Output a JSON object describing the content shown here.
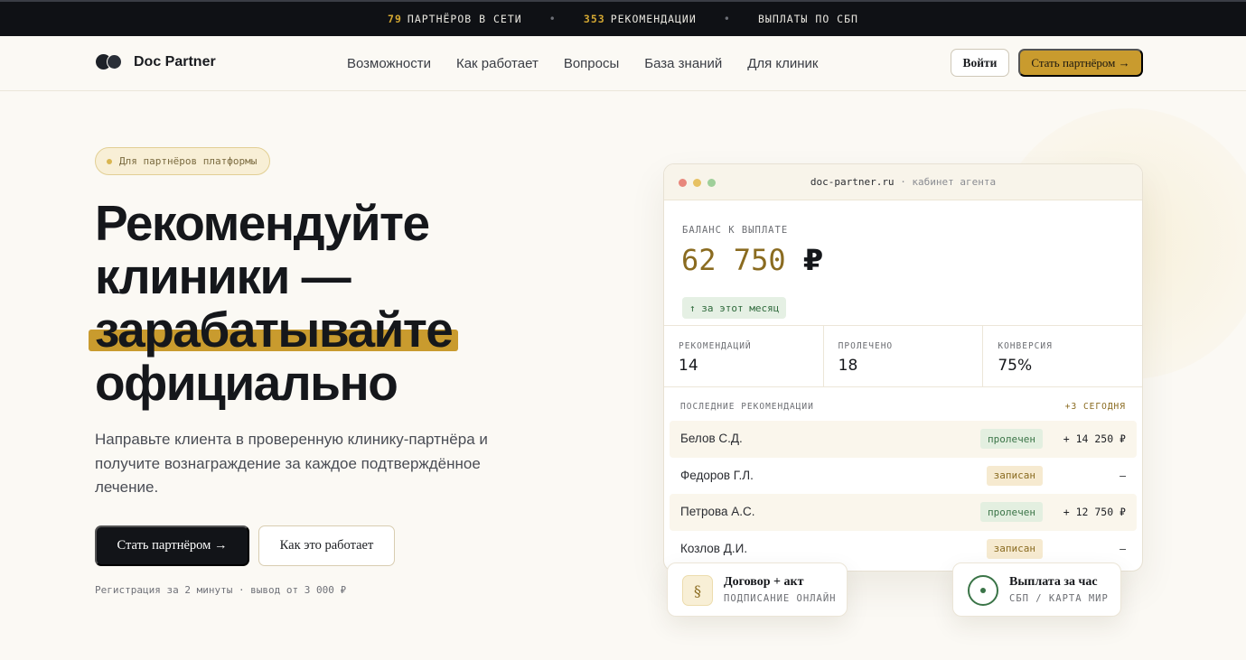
{
  "topbar": {
    "item1_num": "79",
    "item1_text": "ПАРТНЁРОВ В СЕТИ",
    "item2_num": "353",
    "item2_text": "РЕКОМЕНДАЦИИ",
    "item3_text": "ВЫПЛАТЫ ПО СБП",
    "sep": "•"
  },
  "header": {
    "brand": "Doc Partner",
    "nav": [
      "Возможности",
      "Как работает",
      "Вопросы",
      "База знаний",
      "Для клиник"
    ],
    "login": "Войти",
    "cta": "Стать партнёром →"
  },
  "hero": {
    "badge": "Для партнёров платформы",
    "title_line1": "Рекомендуйте",
    "title_line2": "клиники —",
    "title_line3": "зарабатывайте",
    "title_line4": "официально",
    "description": "Направьте клиента в проверенную клинику-партнёра и получите вознаграждение за каждое подтверждённое лечение.",
    "primary_button": "Стать партнёром →",
    "secondary_button": "Как это работает",
    "note": "Регистрация за 2 минуты · вывод от 3 000 ₽"
  },
  "dashboard": {
    "url": "doc-partner.ru",
    "url_sub": "· кабинет агента",
    "balance_label": "БАЛАНС К ВЫПЛАТЕ",
    "balance_value": "62 750",
    "balance_currency": "₽",
    "balance_change": "↑ за этот месяц",
    "stats": [
      {
        "label": "РЕКОМЕНДАЦИЙ",
        "value": "14"
      },
      {
        "label": "ПРОЛЕЧЕНО",
        "value": "18"
      },
      {
        "label": "КОНВЕРСИЯ",
        "value": "75%"
      }
    ],
    "recent_label": "ПОСЛЕДНИЕ РЕКОМЕНДАЦИИ",
    "recent_today": "+3 СЕГОДНЯ",
    "rows": [
      {
        "name": "Белов С.Д.",
        "status": "пролечен",
        "amount": "+ 14 250 ₽"
      },
      {
        "name": "Федоров Г.Л.",
        "status": "записан",
        "amount": "–"
      },
      {
        "name": "Петрова А.С.",
        "status": "пролечен",
        "amount": "+ 12 750 ₽"
      },
      {
        "name": "Козлов Д.И.",
        "status": "записан",
        "amount": "–"
      }
    ],
    "window_dot_colors": [
      "#e8877c",
      "#e7c163",
      "#9fcf9a"
    ]
  },
  "chips": {
    "contract_icon": "§",
    "contract_title": "Договор + акт",
    "contract_sub": "ПОДПИСАНИЕ ОНЛАЙН",
    "payout_title": "Выплата за час",
    "payout_sub": "СБП / КАРТА МИР"
  },
  "colors": {
    "accent": "#c99b2e",
    "dark": "#121418",
    "success": "#3a7447"
  }
}
